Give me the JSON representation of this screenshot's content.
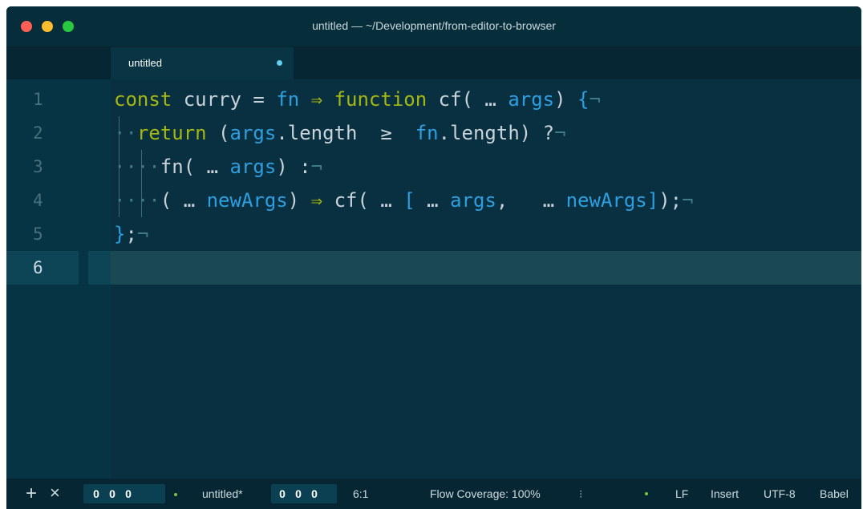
{
  "window": {
    "title": "untitled — ~/Development/from-editor-to-browser",
    "traffic_lights": {
      "close": "#ff5f57",
      "minimize": "#febc2e",
      "zoom": "#28c840"
    }
  },
  "tab": {
    "label": "untitled",
    "modified_indicator_color": "#5fd0ee"
  },
  "editor": {
    "line_numbers": [
      "1",
      "2",
      "3",
      "4",
      "5",
      "6"
    ],
    "active_line": "6",
    "colors": {
      "background": "#083040",
      "keyword": "#a7b712",
      "identifier": "#2d9fe0",
      "text": "#c8d3d9",
      "invisible": "#3f7a86"
    },
    "lines": [
      {
        "tokens": [
          {
            "t": "const",
            "c": "kw"
          },
          {
            "t": " ",
            "c": "pl"
          },
          {
            "t": "curry",
            "c": "pl"
          },
          {
            "t": " = ",
            "c": "pl"
          },
          {
            "t": "fn",
            "c": "bl"
          },
          {
            "t": " ",
            "c": "pl"
          },
          {
            "t": "⇒",
            "c": "kw"
          },
          {
            "t": " ",
            "c": "pl"
          },
          {
            "t": "function",
            "c": "kw"
          },
          {
            "t": " cf(",
            "c": "pl"
          },
          {
            "t": " … ",
            "c": "pl"
          },
          {
            "t": "args",
            "c": "bl"
          },
          {
            "t": ") ",
            "c": "pl"
          },
          {
            "t": "{",
            "c": "bl"
          },
          {
            "t": "¬",
            "c": "ws"
          }
        ]
      },
      {
        "tokens": [
          {
            "t": "··",
            "c": "ws"
          },
          {
            "t": "return",
            "c": "kw"
          },
          {
            "t": " (",
            "c": "pl"
          },
          {
            "t": "args",
            "c": "bl"
          },
          {
            "t": ".length",
            "c": "pl"
          },
          {
            "t": "  ≥  ",
            "c": "pl"
          },
          {
            "t": "fn",
            "c": "bl"
          },
          {
            "t": ".length",
            "c": "pl"
          },
          {
            "t": ") ?",
            "c": "pl"
          },
          {
            "t": "¬",
            "c": "ws"
          }
        ]
      },
      {
        "tokens": [
          {
            "t": "····",
            "c": "ws"
          },
          {
            "t": "fn(",
            "c": "pl"
          },
          {
            "t": " … ",
            "c": "pl"
          },
          {
            "t": "args",
            "c": "bl"
          },
          {
            "t": ") :",
            "c": "pl"
          },
          {
            "t": "¬",
            "c": "ws"
          }
        ]
      },
      {
        "tokens": [
          {
            "t": "····",
            "c": "ws"
          },
          {
            "t": "(",
            "c": "pl"
          },
          {
            "t": " … ",
            "c": "pl"
          },
          {
            "t": "newArgs",
            "c": "bl"
          },
          {
            "t": ") ",
            "c": "pl"
          },
          {
            "t": "⇒",
            "c": "kw"
          },
          {
            "t": " cf(",
            "c": "pl"
          },
          {
            "t": " … ",
            "c": "pl"
          },
          {
            "t": "[",
            "c": "bl"
          },
          {
            "t": " … ",
            "c": "pl"
          },
          {
            "t": "args",
            "c": "bl"
          },
          {
            "t": ",  ",
            "c": "pl"
          },
          {
            "t": " … ",
            "c": "pl"
          },
          {
            "t": "newArgs",
            "c": "bl"
          },
          {
            "t": "]",
            "c": "bl"
          },
          {
            "t": ");",
            "c": "pl"
          },
          {
            "t": "¬",
            "c": "ws"
          }
        ]
      },
      {
        "tokens": [
          {
            "t": "}",
            "c": "bl"
          },
          {
            "t": ";",
            "c": "pl"
          },
          {
            "t": "¬",
            "c": "ws"
          }
        ]
      },
      {
        "tokens": []
      }
    ]
  },
  "status_bar": {
    "add_label": "+",
    "close_label": "×",
    "counts_left": [
      "0",
      "0",
      "0"
    ],
    "filename": "untitled*",
    "counts_right": [
      "0",
      "0",
      "0"
    ],
    "cursor_position": "6:1",
    "flow_coverage": "Flow Coverage: 100%",
    "line_ending": "LF",
    "mode": "Insert",
    "encoding": "UTF-8",
    "grammar": "Babel"
  }
}
